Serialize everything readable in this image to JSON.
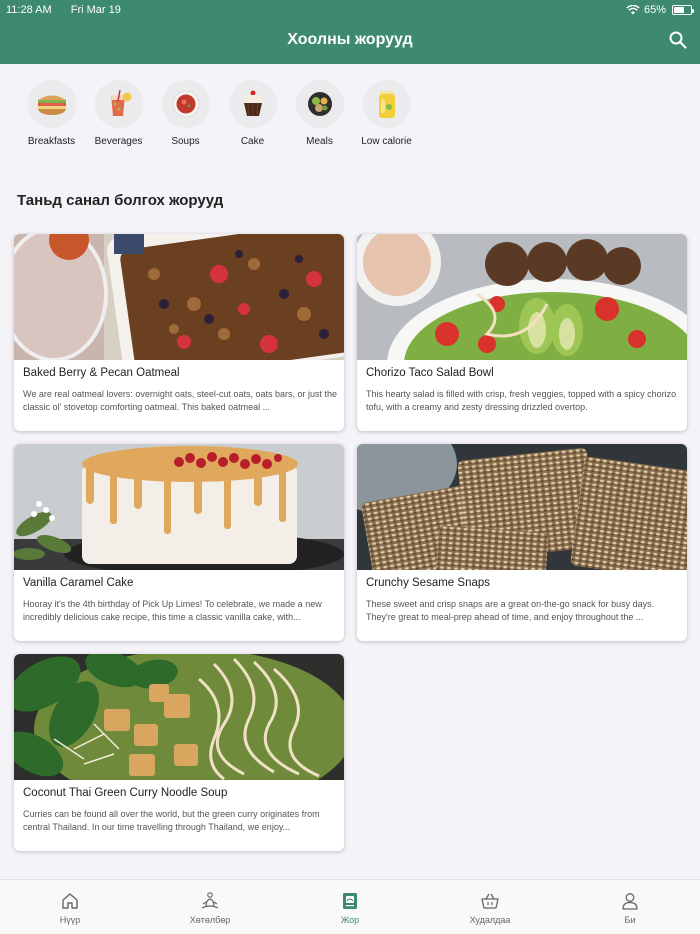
{
  "status_bar": {
    "time": "11:28 AM",
    "date": "Fri Mar 19",
    "battery": "65%",
    "battery_level": 0.65
  },
  "header": {
    "title": "Хоолны жорууд",
    "search_icon": "search-icon"
  },
  "categories": [
    {
      "label": "Breakfasts",
      "icon": "sandwich-icon"
    },
    {
      "label": "Beverages",
      "icon": "drink-icon"
    },
    {
      "label": "Soups",
      "icon": "soup-bowl-icon"
    },
    {
      "label": "Cake",
      "icon": "cupcake-icon"
    },
    {
      "label": "Meals",
      "icon": "meal-bowl-icon"
    },
    {
      "label": "Low calorie",
      "icon": "juice-icon"
    }
  ],
  "section_title": "Таньд санал болгох жорууд",
  "recipes": [
    {
      "title": "Baked Berry & Pecan Oatmeal",
      "description": "We are real oatmeal lovers: overnight oats, steel-cut oats, oats bars, or just the classic ol' stovetop comforting oatmeal. This baked oatmeal ..."
    },
    {
      "title": "Chorizo Taco Salad Bowl",
      "description": "This hearty salad is filled with crisp, fresh veggies, topped with a spicy chorizo tofu, with a creamy and zesty dressing drizzled overtop."
    },
    {
      "title": "Vanilla Caramel Cake",
      "description": "Hooray it's the 4th birthday of Pick Up Limes! To celebrate, we made a new incredibly delicious cake recipe, this time a classic vanilla cake, with..."
    },
    {
      "title": "Crunchy Sesame Snaps",
      "description": "These sweet and crisp snaps are a great on-the-go snack for busy days. They're great to meal-prep ahead of time, and enjoy throughout the ..."
    },
    {
      "title": "Coconut Thai Green Curry Noodle Soup",
      "description": "Curries can be found all over the world, but the green curry originates from central Thailand. In our time travelling through Thailand, we enjoy..."
    }
  ],
  "tabs": [
    {
      "label": "Нүүр",
      "icon": "home-icon"
    },
    {
      "label": "Хөтөлбөр",
      "icon": "meditation-icon"
    },
    {
      "label": "Жор",
      "icon": "recipe-book-icon",
      "active": true
    },
    {
      "label": "Худалдаа",
      "icon": "shopping-basket-icon"
    },
    {
      "label": "Би",
      "icon": "user-icon"
    }
  ],
  "colors": {
    "brand": "#3e8a70",
    "background": "#f4f3f8",
    "inactive_tab": "#666666"
  }
}
